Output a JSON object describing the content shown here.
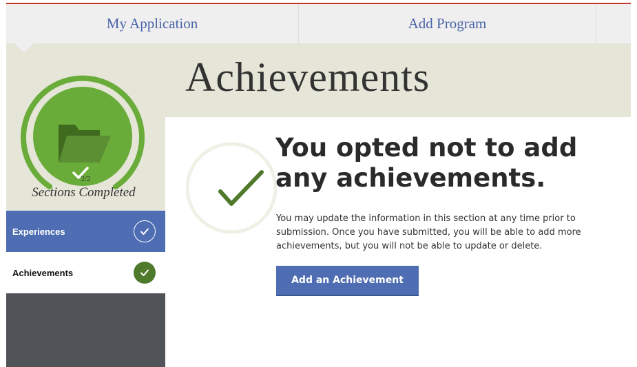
{
  "nav": {
    "tabs": [
      {
        "label": "My Application"
      },
      {
        "label": "Add Program"
      }
    ]
  },
  "sidebar": {
    "progress": {
      "count": "2/2",
      "completed_fraction": 1.0,
      "label": "Sections Completed",
      "icon": "folder-icon"
    },
    "items": [
      {
        "label": "Experiences",
        "status": "complete",
        "active": false
      },
      {
        "label": "Achievements",
        "status": "complete",
        "active": true
      }
    ]
  },
  "main": {
    "title": "Achievements",
    "headline": "You opted not to add any achievements.",
    "description": "You may update the information in this section at any time prior to submission. Once you have submitted, you will be able to add more achievements, but you will not be able to update or delete.",
    "button_label": "Add an Achievement"
  },
  "colors": {
    "accent_blue": "#4f6db2",
    "progress_green": "#6aac3a",
    "check_green": "#4f7a2c",
    "top_border_red": "#c0392b",
    "band_beige": "#e5e5d8"
  }
}
